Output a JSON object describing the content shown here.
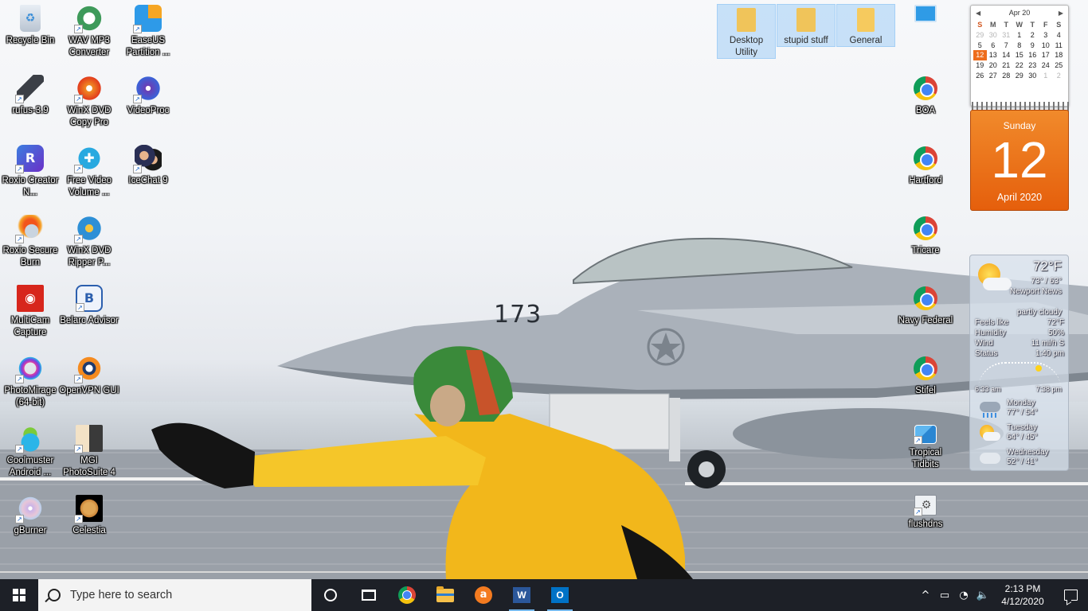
{
  "desktop": {
    "left_icons": [
      {
        "label": "Recycle Bin"
      },
      {
        "label": "WAV MP3 Converter"
      },
      {
        "label": "EaseUS Partition ..."
      },
      {
        "label": "rufus-3.9"
      },
      {
        "label": "WinX DVD Copy Pro"
      },
      {
        "label": "VideoProc"
      },
      {
        "label": "Roxio Creator N..."
      },
      {
        "label": "Free Video Volume ..."
      },
      {
        "label": "IceChat 9"
      },
      {
        "label": "Roxio Secure Burn"
      },
      {
        "label": "WinX DVD Ripper P..."
      },
      {
        "label": "MultiCam Capture"
      },
      {
        "label": "Belarc Advisor"
      },
      {
        "label": "PhotoMirage (64-bit)"
      },
      {
        "label": "OpenVPN GUI"
      },
      {
        "label": "Coolmuster Android ..."
      },
      {
        "label": "MGI PhotoSuite 4"
      },
      {
        "label": "gBurner"
      },
      {
        "label": "Celestia"
      }
    ],
    "top_folders": [
      {
        "label": "Desktop Utility"
      },
      {
        "label": "stupid stuff"
      },
      {
        "label": "General"
      }
    ],
    "right_icons": [
      {
        "label": "BOA"
      },
      {
        "label": "Hartford"
      },
      {
        "label": "Tricare"
      },
      {
        "label": "Navy Federal"
      },
      {
        "label": "Stifel"
      },
      {
        "label": "Tropical Tidbits"
      },
      {
        "label": "flushdns"
      }
    ],
    "wallpaper_text": {
      "tail_number": "173"
    }
  },
  "calendar": {
    "month_label": "Apr 20",
    "prev": "◀",
    "next": "▶",
    "weekdays": [
      "S",
      "M",
      "T",
      "W",
      "T",
      "F",
      "S"
    ],
    "weeks": [
      [
        "29",
        "30",
        "31",
        "1",
        "2",
        "3",
        "4"
      ],
      [
        "5",
        "6",
        "7",
        "8",
        "9",
        "10",
        "11"
      ],
      [
        "12",
        "13",
        "14",
        "15",
        "16",
        "17",
        "18"
      ],
      [
        "19",
        "20",
        "21",
        "22",
        "23",
        "24",
        "25"
      ],
      [
        "26",
        "27",
        "28",
        "29",
        "30",
        "1",
        "2"
      ]
    ],
    "weekday_name": "Sunday",
    "day_number": "12",
    "month_year": "April 2020"
  },
  "weather": {
    "temp": "72°F",
    "hilo": "73° / 63°",
    "city": "Newport News",
    "condition": "partly cloudy",
    "details": [
      {
        "label": "Feels like",
        "value": "72°F"
      },
      {
        "label": "Humidity",
        "value": "50%"
      },
      {
        "label": "Wind",
        "value": "11 mi/h S"
      },
      {
        "label": "Status",
        "value": "1:40 pm"
      }
    ],
    "sunrise": "6:33 am",
    "sunset": "7:38 pm",
    "forecast": [
      {
        "day": "Monday",
        "temps": "77° / 54°"
      },
      {
        "day": "Tuesday",
        "temps": "64° / 45°"
      },
      {
        "day": "Wednesday",
        "temps": "52° / 41°"
      }
    ]
  },
  "taskbar": {
    "search_placeholder": "Type here to search",
    "pinned": [
      "chrome-icon",
      "file-explorer-icon",
      "avast-icon",
      "word-icon",
      "outlook-icon"
    ],
    "word_letter": "W",
    "outlook_letter": "O",
    "avast_letter": "a",
    "tray_glyphs": {
      "chevron": "^",
      "battery": "▭",
      "wifi": "◔",
      "volume": "🔈"
    },
    "time": "2:13 PM",
    "date": "4/12/2020"
  },
  "colors": {
    "accent_orange": "#ee6d1c",
    "taskbar_bg": "#1d2027",
    "selection_blue": "#a0cdf5"
  }
}
